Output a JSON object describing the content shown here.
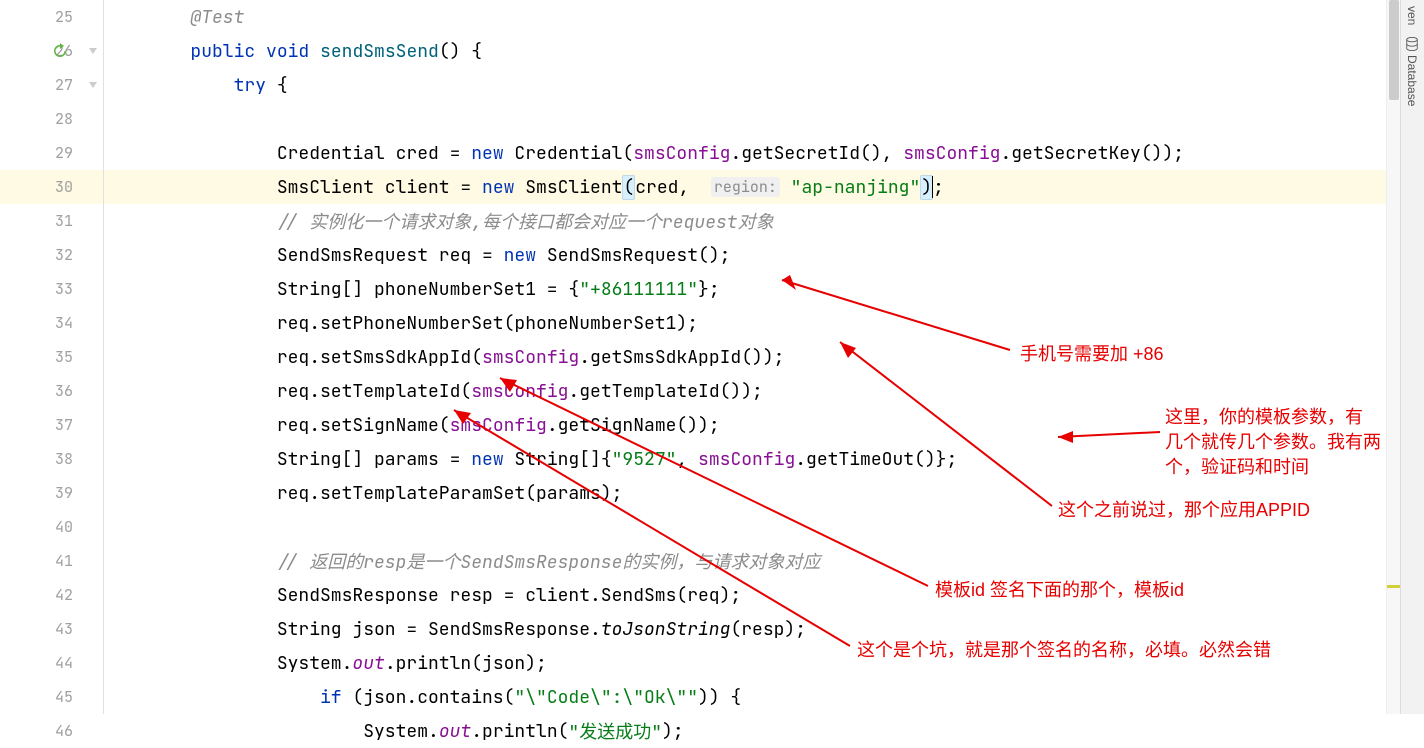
{
  "gutter": {
    "start": 25,
    "end": 46,
    "highlighted": 30,
    "run_icon_line": 26
  },
  "code": {
    "l25": "        @Test",
    "l26_kw1": "public",
    "l26_kw2": "void",
    "l26_method": "sendSmsSend",
    "l26_rest": "() {",
    "l27_kw": "try",
    "l27_rest": " {",
    "l29_p1": "Credential cred = ",
    "l29_kw": "new",
    "l29_p2": " Credential(",
    "l29_f1": "smsConfig",
    "l29_p3": ".getSecretId(), ",
    "l29_f2": "smsConfig",
    "l29_p4": ".getSecretKey());",
    "l30_p1": "SmsClient client = ",
    "l30_kw": "new",
    "l30_p2": " SmsClient",
    "l30_br1": "(",
    "l30_p3": "cred,  ",
    "l30_hint": "region:",
    "l30_sp": " ",
    "l30_str": "\"ap-nanjing\"",
    "l30_br2": ")",
    "l30_p4": ";",
    "l31_c": "// 实例化一个请求对象,每个接口都会对应一个request对象",
    "l32_p1": "SendSmsRequest req = ",
    "l32_kw": "new",
    "l32_p2": " SendSmsRequest();",
    "l33_p1": "String[] phoneNumberSet1 = {",
    "l33_str": "\"+86111111\"",
    "l33_p2": "};",
    "l34": "req.setPhoneNumberSet(phoneNumberSet1);",
    "l35_p1": "req.setSmsSdkAppId(",
    "l35_f": "smsConfig",
    "l35_p2": ".getSmsSdkAppId());",
    "l36_p1": "req.setTemplateId(",
    "l36_f": "smsConfig",
    "l36_p2": ".getTemplateId());",
    "l37_p1": "req.setSignName(",
    "l37_f": "smsConfig",
    "l37_p2": ".getSignName());",
    "l38_p1": "String[] params = ",
    "l38_kw": "new",
    "l38_p2": " String[]{",
    "l38_str": "\"9527\"",
    "l38_p3": ", ",
    "l38_f": "smsConfig",
    "l38_p4": ".getTimeOut()};",
    "l39": "req.setTemplateParamSet(params);",
    "l41_c": "// 返回的resp是一个SendSmsResponse的实例，与请求对象对应",
    "l42": "SendSmsResponse resp = client.SendSms(req);",
    "l43_p1": "String json = SendSmsResponse.",
    "l43_m": "toJsonString",
    "l43_p2": "(resp);",
    "l44_p1": "System.",
    "l44_f": "out",
    "l44_p2": ".println(json);",
    "l45_kw": "if",
    "l45_p1": " (json.contains(",
    "l45_str": "\"\\\"Code\\\":\\\"Ok\\\"\"",
    "l45_p2": ")) {",
    "l46_p1": "System.",
    "l46_f": "out",
    "l46_p2": ".println(",
    "l46_str": "\"发送成功\"",
    "l46_p3": ");"
  },
  "annotations": {
    "a1": "手机号需要加 +86",
    "a2": "这里，你的模板参数，有\n几个就传几个参数。我有两\n个，验证码和时间",
    "a3": "这个之前说过，那个应用APPID",
    "a4": "模板id 签名下面的那个，模板id",
    "a5": "这个是个坑，就是那个签名的名称，必填。必然会错"
  },
  "tabs": {
    "maven": "ven",
    "database": "Database"
  }
}
